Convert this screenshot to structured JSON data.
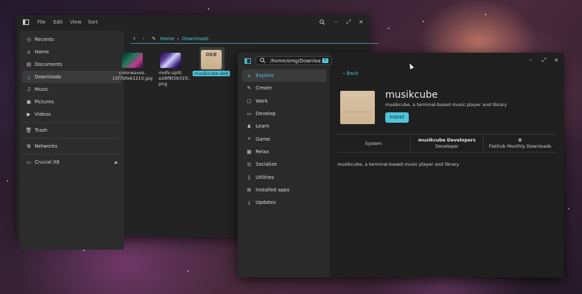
{
  "file_manager": {
    "menu": [
      "File",
      "Edit",
      "View",
      "Sort"
    ],
    "sidebar": [
      {
        "label": "Recents",
        "icon": "clock-icon"
      },
      {
        "label": "Home",
        "icon": "home-icon"
      },
      {
        "label": "Documents",
        "icon": "document-icon"
      },
      {
        "label": "Downloads",
        "icon": "download-icon",
        "active": true
      },
      {
        "label": "Music",
        "icon": "music-icon"
      },
      {
        "label": "Pictures",
        "icon": "picture-icon"
      },
      {
        "label": "Videos",
        "icon": "video-icon"
      },
      {
        "label": "Trash",
        "icon": "trash-icon"
      },
      {
        "label": "Networks",
        "icon": "network-icon"
      },
      {
        "label": "Crucial X8",
        "icon": "drive-icon"
      }
    ],
    "breadcrumb": {
      "home": "Home",
      "current": "Downloads"
    },
    "files": [
      {
        "name": "colorwaves.\n15f7bfe61210.jpg"
      },
      {
        "name": "mofo-split.\ne28f9f2631fc.\npng"
      },
      {
        "name": "musikcube.deb",
        "badge": "DEB",
        "selected": true
      }
    ]
  },
  "software_center": {
    "search_value": "/home/omg/Downloa",
    "nav": [
      {
        "label": "Explore",
        "icon": "explore-icon",
        "active": true
      },
      {
        "label": "Create",
        "icon": "create-icon"
      },
      {
        "label": "Work",
        "icon": "work-icon"
      },
      {
        "label": "Develop",
        "icon": "develop-icon"
      },
      {
        "label": "Learn",
        "icon": "learn-icon"
      },
      {
        "label": "Game",
        "icon": "game-icon"
      },
      {
        "label": "Relax",
        "icon": "relax-icon"
      },
      {
        "label": "Socialize",
        "icon": "socialize-icon"
      },
      {
        "label": "Utilities",
        "icon": "utilities-icon"
      },
      {
        "label": "Installed apps",
        "icon": "installed-icon"
      },
      {
        "label": "Updates",
        "icon": "updates-icon"
      }
    ],
    "back_label": "Back",
    "app": {
      "name": "musikcube",
      "summary": "musikcube, a terminal-based music player and library",
      "install_label": "Install",
      "stats": {
        "source": "System",
        "developer_value": "musikcube Developers",
        "developer_label": "Developer",
        "downloads_value": "0",
        "downloads_label": "Flathub Monthly Downloads"
      },
      "description": "musikcube, a terminal-based music player and library"
    }
  },
  "colors": {
    "accent": "#4fc3d9",
    "window_bg": "#232323",
    "sidebar_bg": "#2c2c2c"
  }
}
